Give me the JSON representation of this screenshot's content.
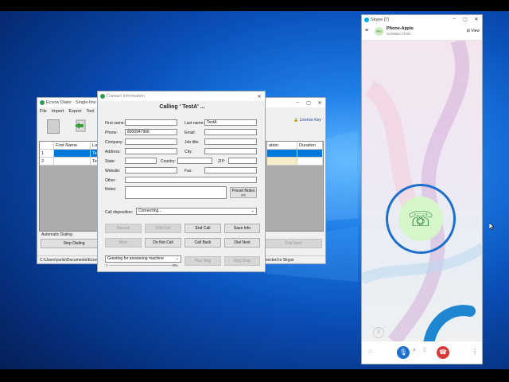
{
  "dialer": {
    "title": "Ecsow Dialer - Single-line",
    "menu": [
      "File",
      "Import",
      "Export",
      "Tool"
    ],
    "license": "License Key",
    "columns": [
      "First Name",
      "La",
      "ation",
      "Duration"
    ],
    "rows": [
      {
        "num": "1",
        "first": "",
        "last": "Tes"
      },
      {
        "num": "2",
        "first": "",
        "last": "Tes"
      }
    ],
    "auto_dialing": "Automatic Dialing",
    "stop_dialing": "Stop Dialing",
    "dial_next": "Dial Next",
    "path": "C:\\Users\\yuriis\\Documents\\Ecsow",
    "status": "nnected to Skype"
  },
  "contact": {
    "title": "Contact Information",
    "heading": "Calling ' TestA' ...",
    "labels": {
      "first_name": "First name:",
      "last_name": "Last name:",
      "phone": "Phone:",
      "email": "Email:",
      "company": "Company:",
      "job_title": "Job title:",
      "address": "Address:",
      "city": "City:",
      "state": "State:",
      "country": "Country:",
      "zip": "ZIP:",
      "website": "Website:",
      "fax": "Fax:",
      "other": "Other:",
      "notes": "Notes:",
      "call_disposition": "Call disposition:"
    },
    "values": {
      "last_name": "TestA",
      "phone": "8006947966",
      "disposition": "Connecting..."
    },
    "preset_notes": "Preset Notes <<",
    "buttons": {
      "record": "Record",
      "dial_fail": "Dial Fail",
      "end_call": "End Call",
      "save_info": "Save Info",
      "mute": "Mute",
      "do_not_call": "Do Not Call",
      "call_back": "Call Back",
      "dial_next": "Dial Next",
      "play_msg": "Play Msg",
      "msg_drop": "Msg Drop"
    },
    "greeting": "Greeting for answering machine",
    "progress_min": "0",
    "progress_pct": "0%"
  },
  "skype": {
    "title": "Skype [7]",
    "avatar": "PH",
    "contact_name": "Phone-Apple",
    "call_status": "CONNECTING",
    "view_label": "View"
  },
  "colors": {
    "skype_blue": "#1c6fcd",
    "hangup_red": "#d93a35",
    "selection": "#0078d7",
    "desktop": "#0a4fb8"
  }
}
